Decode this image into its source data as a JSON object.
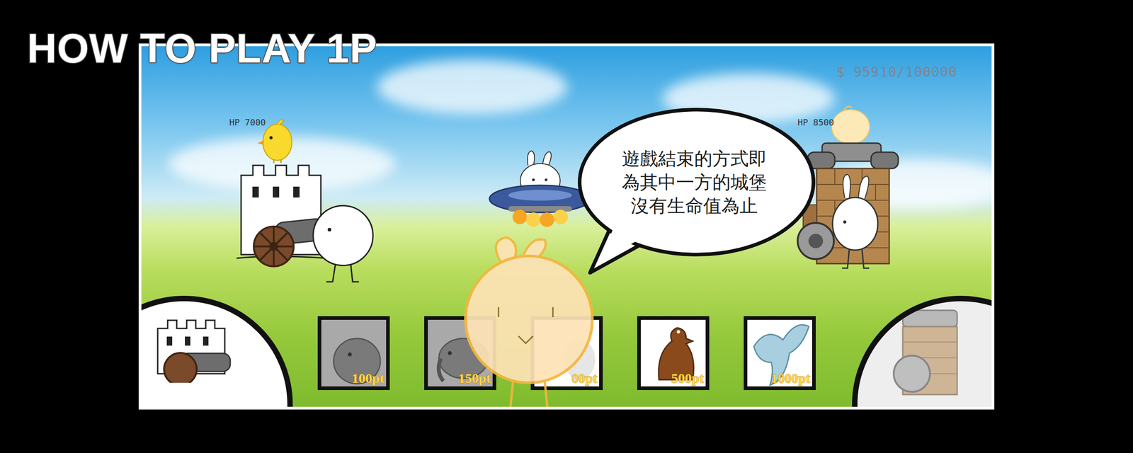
{
  "title": "HOW TO PLAY 1P",
  "money": "$ 95910/100000",
  "player": {
    "hp": "HP 7000"
  },
  "enemy": {
    "hp": "HP 8500"
  },
  "tip": {
    "lines": [
      "遊戲結束的方式即",
      "為其中一方的城堡",
      "沒有生命值為止"
    ]
  },
  "units": [
    {
      "cost": "100pt",
      "disabled": true
    },
    {
      "cost": "150pt",
      "disabled": true
    },
    {
      "cost": "00pt",
      "disabled": false
    },
    {
      "cost": "500pt",
      "disabled": false
    },
    {
      "cost": "1000pt",
      "disabled": false
    }
  ]
}
